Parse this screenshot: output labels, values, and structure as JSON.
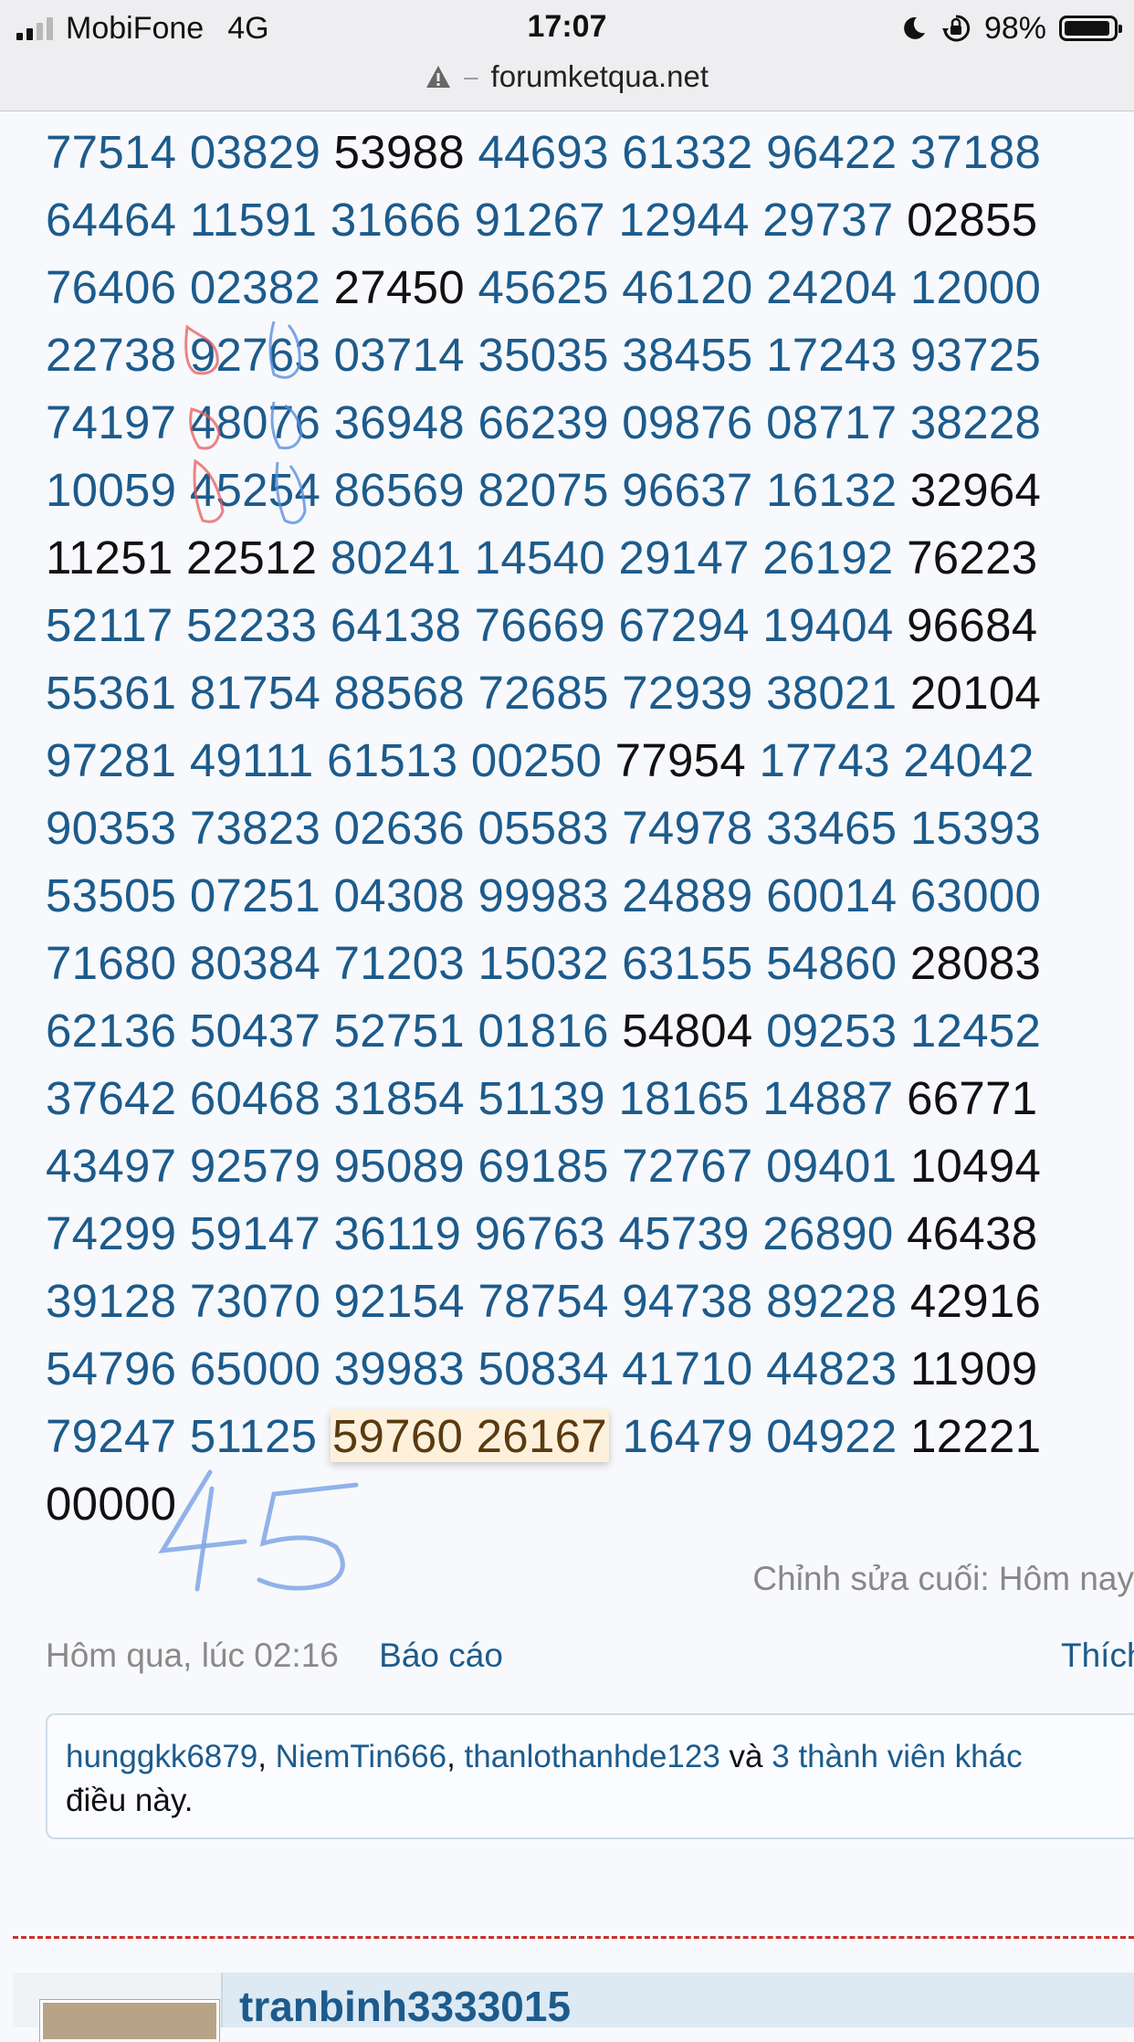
{
  "status_bar": {
    "carrier": "MobiFone",
    "network": "4G",
    "time": "17:07",
    "battery_percent": "98%",
    "icons": [
      "signal-icon",
      "moon-icon",
      "orientation-lock-icon",
      "battery-icon"
    ]
  },
  "url_bar": {
    "url": "forumketqua.net",
    "separator": "–",
    "icon": "warning-icon"
  },
  "numbers": [
    [
      {
        "v": "77514",
        "c": "b"
      },
      {
        "v": "03829",
        "c": "b"
      },
      {
        "v": "53988",
        "c": "k"
      },
      {
        "v": "44693",
        "c": "b"
      },
      {
        "v": "61332",
        "c": "b"
      },
      {
        "v": "96422",
        "c": "b"
      },
      {
        "v": "37188",
        "c": "b"
      }
    ],
    [
      {
        "v": "64464",
        "c": "b"
      },
      {
        "v": "11591",
        "c": "b"
      },
      {
        "v": "31666",
        "c": "b"
      },
      {
        "v": "91267",
        "c": "b"
      },
      {
        "v": "12944",
        "c": "b"
      },
      {
        "v": "29737",
        "c": "b"
      },
      {
        "v": "02855",
        "c": "k"
      }
    ],
    [
      {
        "v": "76406",
        "c": "b"
      },
      {
        "v": "02382",
        "c": "b"
      },
      {
        "v": "27450",
        "c": "k"
      },
      {
        "v": "45625",
        "c": "b"
      },
      {
        "v": "46120",
        "c": "b"
      },
      {
        "v": "24204",
        "c": "b"
      },
      {
        "v": "12000",
        "c": "b"
      }
    ],
    [
      {
        "v": "22738",
        "c": "b"
      },
      {
        "v": "92763",
        "c": "b"
      },
      {
        "v": "03714",
        "c": "b"
      },
      {
        "v": "35035",
        "c": "b"
      },
      {
        "v": "38455",
        "c": "b"
      },
      {
        "v": "17243",
        "c": "b"
      },
      {
        "v": "93725",
        "c": "b"
      }
    ],
    [
      {
        "v": "74197",
        "c": "b"
      },
      {
        "v": "48076",
        "c": "b"
      },
      {
        "v": "36948",
        "c": "b"
      },
      {
        "v": "66239",
        "c": "b"
      },
      {
        "v": "09876",
        "c": "b"
      },
      {
        "v": "08717",
        "c": "b"
      },
      {
        "v": "38228",
        "c": "b"
      }
    ],
    [
      {
        "v": "10059",
        "c": "b"
      },
      {
        "v": "45254",
        "c": "b"
      },
      {
        "v": "86569",
        "c": "b"
      },
      {
        "v": "82075",
        "c": "b"
      },
      {
        "v": "96637",
        "c": "b"
      },
      {
        "v": "16132",
        "c": "b"
      },
      {
        "v": "32964",
        "c": "k"
      }
    ],
    [
      {
        "v": "11251",
        "c": "k"
      },
      {
        "v": "22512",
        "c": "k"
      },
      {
        "v": "80241",
        "c": "b"
      },
      {
        "v": "14540",
        "c": "b"
      },
      {
        "v": "29147",
        "c": "b"
      },
      {
        "v": "26192",
        "c": "b"
      },
      {
        "v": "76223",
        "c": "k"
      }
    ],
    [
      {
        "v": "52117",
        "c": "b"
      },
      {
        "v": "52233",
        "c": "b"
      },
      {
        "v": "64138",
        "c": "b"
      },
      {
        "v": "76669",
        "c": "b"
      },
      {
        "v": "67294",
        "c": "b"
      },
      {
        "v": "19404",
        "c": "b"
      },
      {
        "v": "96684",
        "c": "k"
      }
    ],
    [
      {
        "v": "55361",
        "c": "b"
      },
      {
        "v": "81754",
        "c": "b"
      },
      {
        "v": "88568",
        "c": "b"
      },
      {
        "v": "72685",
        "c": "b"
      },
      {
        "v": "72939",
        "c": "b"
      },
      {
        "v": "38021",
        "c": "b"
      },
      {
        "v": "20104",
        "c": "k"
      }
    ],
    [
      {
        "v": "97281",
        "c": "b"
      },
      {
        "v": "49111",
        "c": "b"
      },
      {
        "v": "61513",
        "c": "b"
      },
      {
        "v": "00250",
        "c": "b"
      },
      {
        "v": "77954",
        "c": "k"
      },
      {
        "v": "17743",
        "c": "b"
      },
      {
        "v": "24042",
        "c": "b"
      }
    ],
    [
      {
        "v": "90353",
        "c": "b"
      },
      {
        "v": "73823",
        "c": "b"
      },
      {
        "v": "02636",
        "c": "b"
      },
      {
        "v": "05583",
        "c": "b"
      },
      {
        "v": "74978",
        "c": "b"
      },
      {
        "v": "33465",
        "c": "b"
      },
      {
        "v": "15393",
        "c": "b"
      }
    ],
    [
      {
        "v": "53505",
        "c": "b"
      },
      {
        "v": "07251",
        "c": "b"
      },
      {
        "v": "04308",
        "c": "b"
      },
      {
        "v": "99983",
        "c": "b"
      },
      {
        "v": "24889",
        "c": "b"
      },
      {
        "v": "60014",
        "c": "b"
      },
      {
        "v": "63000",
        "c": "b"
      }
    ],
    [
      {
        "v": "71680",
        "c": "b"
      },
      {
        "v": "80384",
        "c": "b"
      },
      {
        "v": "71203",
        "c": "b"
      },
      {
        "v": "15032",
        "c": "b"
      },
      {
        "v": "63155",
        "c": "b"
      },
      {
        "v": "54860",
        "c": "b"
      },
      {
        "v": "28083",
        "c": "k"
      }
    ],
    [
      {
        "v": "62136",
        "c": "b"
      },
      {
        "v": "50437",
        "c": "b"
      },
      {
        "v": "52751",
        "c": "b"
      },
      {
        "v": "01816",
        "c": "b"
      },
      {
        "v": "54804",
        "c": "k"
      },
      {
        "v": "09253",
        "c": "b"
      },
      {
        "v": "12452",
        "c": "b"
      }
    ],
    [
      {
        "v": "37642",
        "c": "b"
      },
      {
        "v": "60468",
        "c": "b"
      },
      {
        "v": "31854",
        "c": "b"
      },
      {
        "v": "51139",
        "c": "b"
      },
      {
        "v": "18165",
        "c": "b"
      },
      {
        "v": "14887",
        "c": "b"
      },
      {
        "v": "66771",
        "c": "k"
      }
    ],
    [
      {
        "v": "43497",
        "c": "b"
      },
      {
        "v": "92579",
        "c": "b"
      },
      {
        "v": "95089",
        "c": "b"
      },
      {
        "v": "69185",
        "c": "b"
      },
      {
        "v": "72767",
        "c": "b"
      },
      {
        "v": "09401",
        "c": "b"
      },
      {
        "v": "10494",
        "c": "k"
      }
    ],
    [
      {
        "v": "74299",
        "c": "b"
      },
      {
        "v": "59147",
        "c": "b"
      },
      {
        "v": "36119",
        "c": "b"
      },
      {
        "v": "96763",
        "c": "b"
      },
      {
        "v": "45739",
        "c": "b"
      },
      {
        "v": "26890",
        "c": "b"
      },
      {
        "v": "46438",
        "c": "k"
      }
    ],
    [
      {
        "v": "39128",
        "c": "b"
      },
      {
        "v": "73070",
        "c": "b"
      },
      {
        "v": "92154",
        "c": "b"
      },
      {
        "v": "78754",
        "c": "b"
      },
      {
        "v": "94738",
        "c": "b"
      },
      {
        "v": "89228",
        "c": "b"
      },
      {
        "v": "42916",
        "c": "k"
      }
    ],
    [
      {
        "v": "54796",
        "c": "b"
      },
      {
        "v": "65000",
        "c": "b"
      },
      {
        "v": "39983",
        "c": "b"
      },
      {
        "v": "50834",
        "c": "b"
      },
      {
        "v": "41710",
        "c": "b"
      },
      {
        "v": "44823",
        "c": "b"
      },
      {
        "v": "11909",
        "c": "k"
      }
    ],
    [
      {
        "v": "79247",
        "c": "b"
      },
      {
        "v": "51125",
        "c": "b"
      },
      {
        "v": "59760 26167",
        "c": "h"
      },
      {
        "v": "16479",
        "c": "b"
      },
      {
        "v": "04922",
        "c": "b"
      },
      {
        "v": "12221",
        "c": "k"
      }
    ],
    [
      {
        "v": "00000",
        "c": "k"
      }
    ]
  ],
  "handwriting": "45",
  "post_footer": {
    "edited_note": "Chỉnh sửa cuối: Hôm nay",
    "date": "Hôm qua, lúc 02:16",
    "report_link": "Báo cáo",
    "like_link": "Thích"
  },
  "likes": {
    "users": [
      "hunggkk6879",
      "NiemTin666",
      "thanlothanhde123"
    ],
    "separator": ",",
    "and": "và",
    "others": "3 thành viên khác",
    "suffix": "điều này."
  },
  "next_post": {
    "username": "tranbinh3333015"
  },
  "colors": {
    "link_blue": "#1c5b8c",
    "black_number": "#111111",
    "highlight_bg": "#fdf1dc",
    "divider_red": "#c9302c",
    "scribble_red": "#e85a5a",
    "scribble_blue": "#5a8fe0"
  }
}
